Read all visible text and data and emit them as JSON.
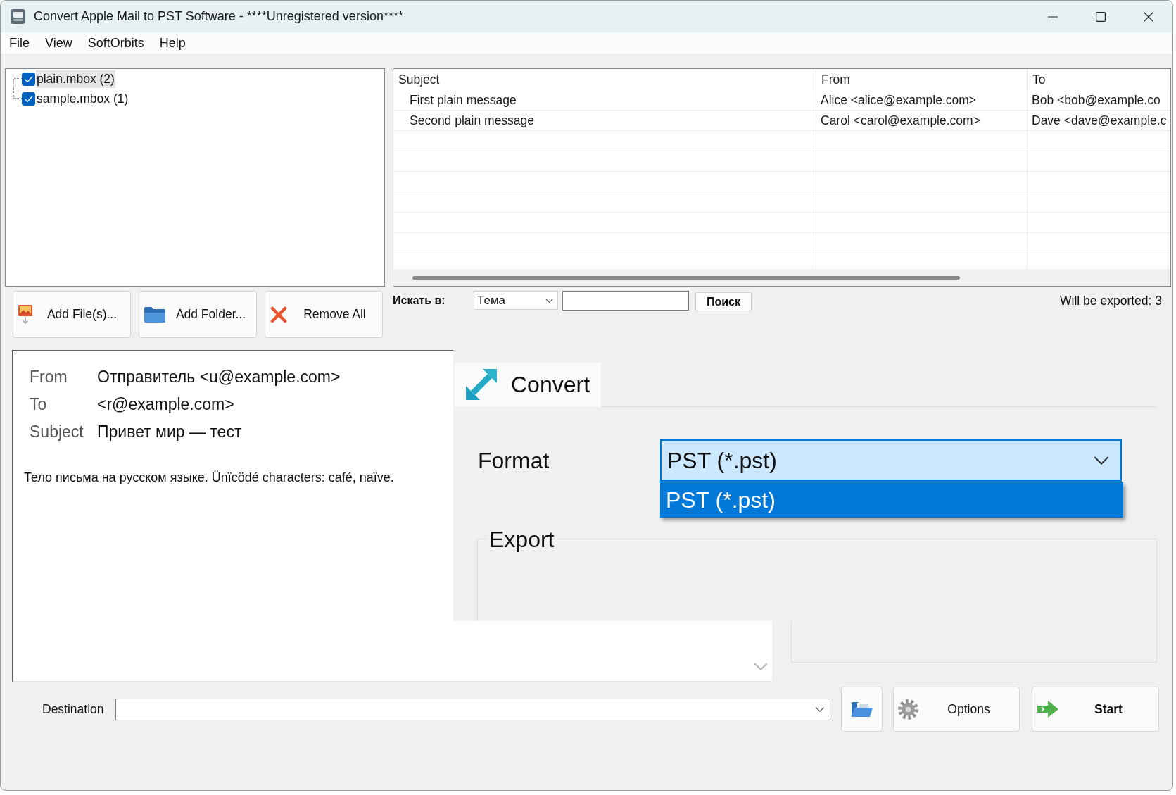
{
  "window": {
    "title": "Convert Apple Mail to PST Software - ****Unregistered version****"
  },
  "menu": [
    {
      "label": "File"
    },
    {
      "label": "View"
    },
    {
      "label": "SoftOrbits"
    },
    {
      "label": "Help"
    }
  ],
  "mailbox_tree": {
    "items": [
      {
        "label": "plain.mbox (2)",
        "checked": true,
        "selected": true
      },
      {
        "label": "sample.mbox (1)",
        "checked": true,
        "selected": false
      }
    ]
  },
  "message_table": {
    "columns": [
      "Subject",
      "From",
      "To"
    ],
    "rows": [
      {
        "cells": [
          "First plain message",
          "Alice <alice@example.com>",
          "Bob <bob@example.co"
        ]
      },
      {
        "cells": [
          "Second plain message",
          "Carol <carol@example.com>",
          "Dave <dave@example.c"
        ]
      }
    ]
  },
  "file_buttons": [
    {
      "kind": "add-files",
      "label": "Add File(s)..."
    },
    {
      "kind": "add-folder",
      "label": "Add Folder..."
    },
    {
      "kind": "remove-all",
      "label": "Remove All"
    }
  ],
  "search": {
    "label": "Искать в:",
    "scope": "Тема",
    "button": "Поиск"
  },
  "export_count": "Will be exported: 3",
  "preview": {
    "headers": [
      {
        "label": "From",
        "value": "Отправитель <u@example.com>"
      },
      {
        "label": "To",
        "value": "<r@example.com>"
      },
      {
        "label": "Subject",
        "value": "Привет мир — тест"
      }
    ],
    "body": "Тело письма на русском языке. Ünïcödé characters: café, naïve."
  },
  "tabs": [
    {
      "label": "Convert",
      "selected": true
    }
  ],
  "format": {
    "label": "Format",
    "value": "PST (*.pst)",
    "expanded": true,
    "options": [
      {
        "label": "PST (*.pst)",
        "selected": true
      }
    ]
  },
  "export_group": {
    "label": "Export"
  },
  "destination": {
    "label": "Destination"
  },
  "action_buttons": [
    {
      "kind": "browse"
    },
    {
      "kind": "options",
      "label": "Options"
    },
    {
      "kind": "start",
      "label": "Start"
    }
  ]
}
